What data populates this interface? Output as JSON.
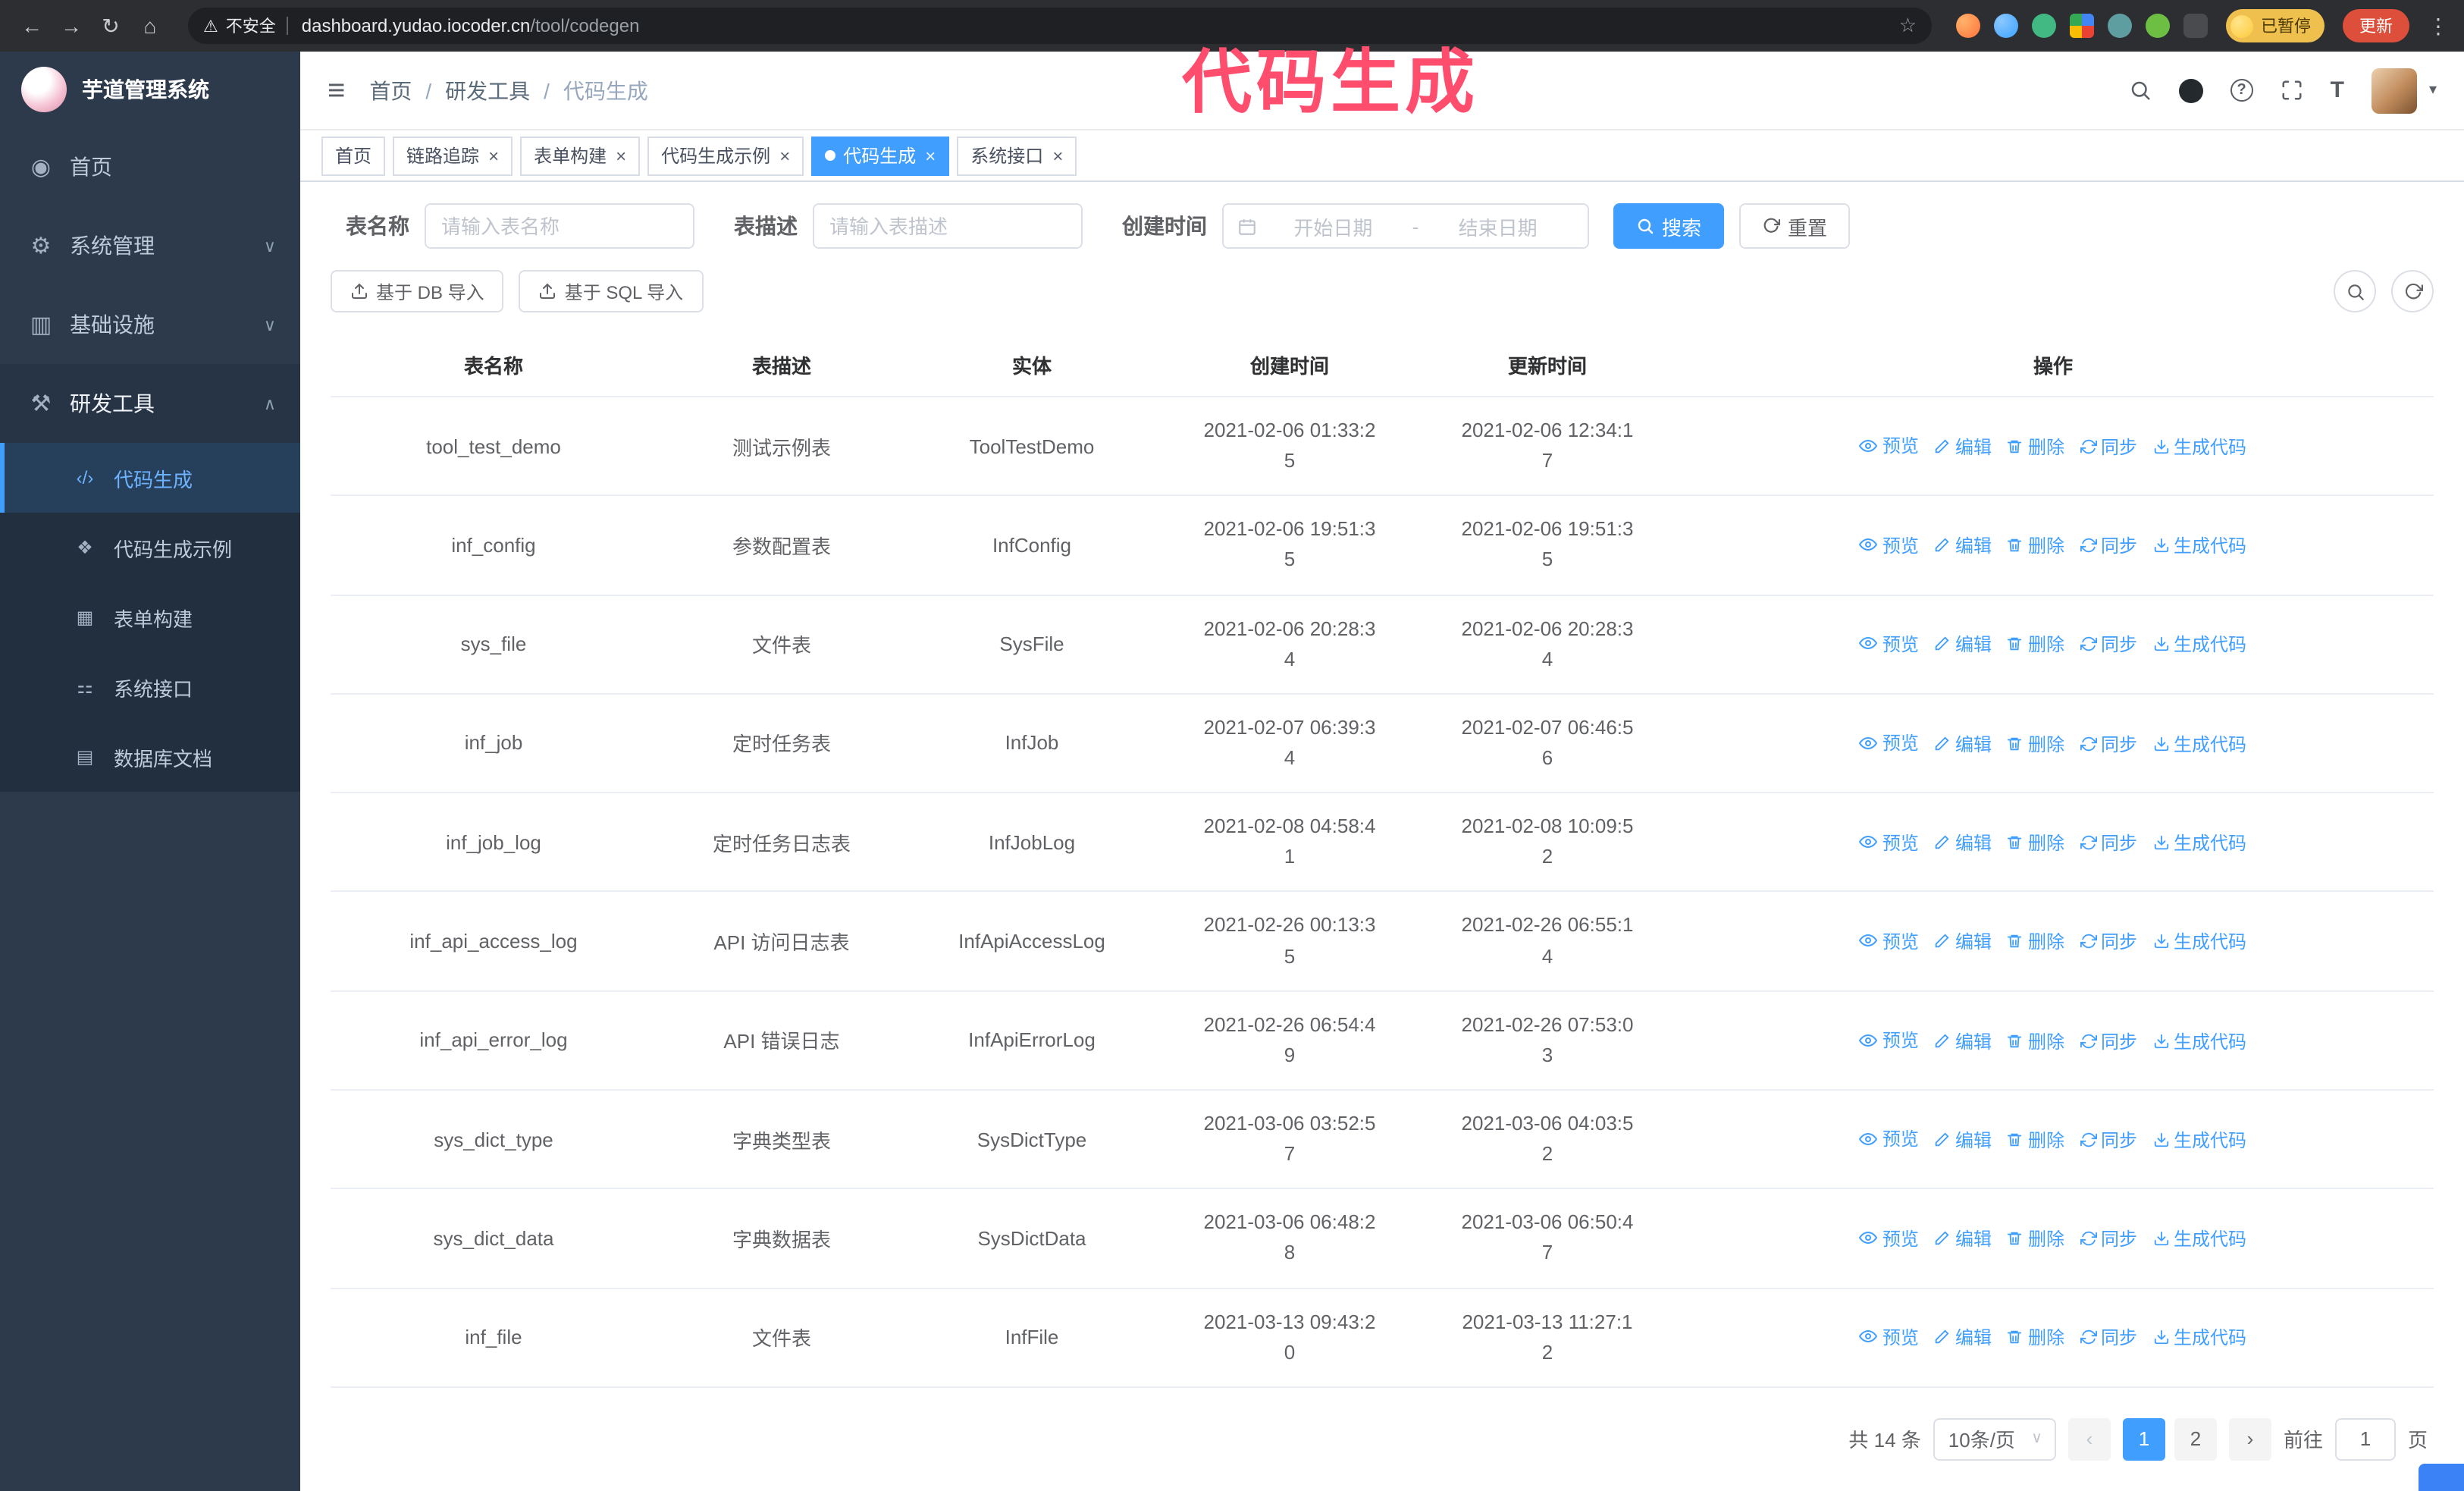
{
  "theme": {
    "accent": "#409eff",
    "sidebar_bg": "#2d3a4b",
    "submenu_bg": "#222f3f",
    "annotation_color": "#ff4d6e"
  },
  "browser": {
    "security_warning": "不安全",
    "url_host": "dashboard.yudao.iocoder.cn",
    "url_path": "/tool/codegen",
    "paused_badge": "已暂停",
    "update_button": "更新"
  },
  "icons": {
    "back": "←",
    "forward": "→",
    "reload": "↻",
    "home": "⌂",
    "warning": "⚠",
    "star": "☆",
    "menu_dots": "⋮",
    "hamburger": "≡",
    "breadcrumb_sep": "/",
    "chevron_up": "∧",
    "chevron_down": "∨",
    "close": "×",
    "select_caret": "∨",
    "prev_arrow": "‹",
    "next_arrow": "›",
    "avatar_caret": "▾",
    "question": "?",
    "font_size": "T"
  },
  "annotation": {
    "text": "代码生成"
  },
  "sidebar": {
    "logo_title": "芋道管理系统",
    "items": [
      {
        "label": "首页",
        "icon": "◉",
        "icon_name": "dashboard-icon",
        "expandable": false,
        "expanded": false,
        "active": false
      },
      {
        "label": "系统管理",
        "icon": "⚙",
        "icon_name": "gear-icon",
        "expandable": true,
        "expanded": false,
        "active": false
      },
      {
        "label": "基础设施",
        "icon": "▥",
        "icon_name": "infrastructure-icon",
        "expandable": true,
        "expanded": false,
        "active": false
      },
      {
        "label": "研发工具",
        "icon": "⚒",
        "icon_name": "dev-tools-icon",
        "expandable": true,
        "expanded": true,
        "active": true
      }
    ],
    "sub_items": [
      {
        "label": "代码生成",
        "icon": "‹/›",
        "icon_name": "code-icon",
        "active": true
      },
      {
        "label": "代码生成示例",
        "icon": "❖",
        "icon_name": "code-example-icon",
        "active": false
      },
      {
        "label": "表单构建",
        "icon": "▦",
        "icon_name": "form-builder-icon",
        "active": false
      },
      {
        "label": "系统接口",
        "icon": "⚏",
        "icon_name": "api-icon",
        "active": false
      },
      {
        "label": "数据库文档",
        "icon": "▤",
        "icon_name": "db-doc-icon",
        "active": false
      }
    ]
  },
  "header": {
    "breadcrumb": [
      "首页",
      "研发工具",
      "代码生成"
    ]
  },
  "tabs": [
    {
      "label": "首页",
      "closable": false,
      "active": false
    },
    {
      "label": "链路追踪",
      "closable": true,
      "active": false
    },
    {
      "label": "表单构建",
      "closable": true,
      "active": false
    },
    {
      "label": "代码生成示例",
      "closable": true,
      "active": false
    },
    {
      "label": "代码生成",
      "closable": true,
      "active": true
    },
    {
      "label": "系统接口",
      "closable": true,
      "active": false
    }
  ],
  "filters": {
    "table_name_label": "表名称",
    "table_name_placeholder": "请输入表名称",
    "table_desc_label": "表描述",
    "table_desc_placeholder": "请输入表描述",
    "create_time_label": "创建时间",
    "date_start_placeholder": "开始日期",
    "date_separator": "-",
    "date_end_placeholder": "结束日期",
    "search_button": "搜索",
    "reset_button": "重置"
  },
  "toolbar": {
    "import_db": "基于 DB 导入",
    "import_sql": "基于 SQL 导入"
  },
  "table": {
    "columns": [
      "表名称",
      "表描述",
      "实体",
      "创建时间",
      "更新时间",
      "操作"
    ],
    "actions": [
      "预览",
      "编辑",
      "删除",
      "同步",
      "生成代码"
    ],
    "rows": [
      {
        "name": "tool_test_demo",
        "desc": "测试示例表",
        "entity": "ToolTestDemo",
        "created": "2021-02-06 01:33:25",
        "updated": "2021-02-06 12:34:17"
      },
      {
        "name": "inf_config",
        "desc": "参数配置表",
        "entity": "InfConfig",
        "created": "2021-02-06 19:51:35",
        "updated": "2021-02-06 19:51:35"
      },
      {
        "name": "sys_file",
        "desc": "文件表",
        "entity": "SysFile",
        "created": "2021-02-06 20:28:34",
        "updated": "2021-02-06 20:28:34"
      },
      {
        "name": "inf_job",
        "desc": "定时任务表",
        "entity": "InfJob",
        "created": "2021-02-07 06:39:34",
        "updated": "2021-02-07 06:46:56"
      },
      {
        "name": "inf_job_log",
        "desc": "定时任务日志表",
        "entity": "InfJobLog",
        "created": "2021-02-08 04:58:41",
        "updated": "2021-02-08 10:09:52"
      },
      {
        "name": "inf_api_access_log",
        "desc": "API 访问日志表",
        "entity": "InfApiAccessLog",
        "created": "2021-02-26 00:13:35",
        "updated": "2021-02-26 06:55:14"
      },
      {
        "name": "inf_api_error_log",
        "desc": "API 错误日志",
        "entity": "InfApiErrorLog",
        "created": "2021-02-26 06:54:49",
        "updated": "2021-02-26 07:53:03"
      },
      {
        "name": "sys_dict_type",
        "desc": "字典类型表",
        "entity": "SysDictType",
        "created": "2021-03-06 03:52:57",
        "updated": "2021-03-06 04:03:52"
      },
      {
        "name": "sys_dict_data",
        "desc": "字典数据表",
        "entity": "SysDictData",
        "created": "2021-03-06 06:48:28",
        "updated": "2021-03-06 06:50:47"
      },
      {
        "name": "inf_file",
        "desc": "文件表",
        "entity": "InfFile",
        "created": "2021-03-13 09:43:20",
        "updated": "2021-03-13 11:27:12"
      }
    ]
  },
  "pagination": {
    "total": "共 14 条",
    "page_size": "10条/页",
    "pages": [
      "1",
      "2"
    ],
    "active_page": "1",
    "goto_label": "前往",
    "goto_value": "1",
    "goto_suffix": "页"
  }
}
